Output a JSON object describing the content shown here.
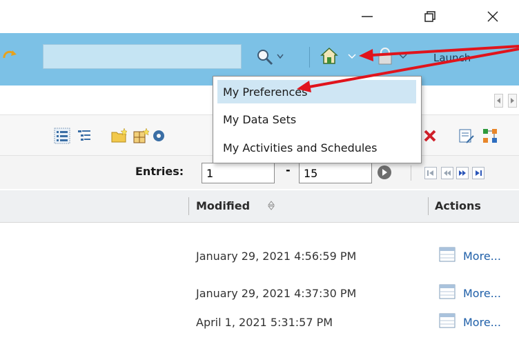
{
  "window": {
    "minimize_icon": "minimize-icon",
    "restore_icon": "restore-icon",
    "close_icon": "close-icon"
  },
  "toolbar": {
    "search_value": "",
    "launch_label": "Launch"
  },
  "menu": {
    "items": [
      {
        "label": "My Preferences",
        "selected": true
      },
      {
        "label": "My Data Sets",
        "selected": false
      },
      {
        "label": "My Activities and Schedules",
        "selected": false
      }
    ]
  },
  "pagination": {
    "label": "Entries:",
    "from": "1",
    "separator": "-",
    "to": "15"
  },
  "table": {
    "columns": {
      "modified": "Modified",
      "actions": "Actions"
    },
    "sort_icon": "sort-icon",
    "rows": [
      {
        "modified": "January 29, 2021 4:56:59 PM",
        "action": "More..."
      },
      {
        "modified": "January 29, 2021 4:37:30 PM",
        "action": "More..."
      },
      {
        "modified": "April 1, 2021 5:31:57 PM",
        "action": "More..."
      }
    ]
  },
  "colors": {
    "toolbar_bg": "#7cc1e6",
    "arrow": "#e0141c",
    "link": "#1f5fa8"
  }
}
